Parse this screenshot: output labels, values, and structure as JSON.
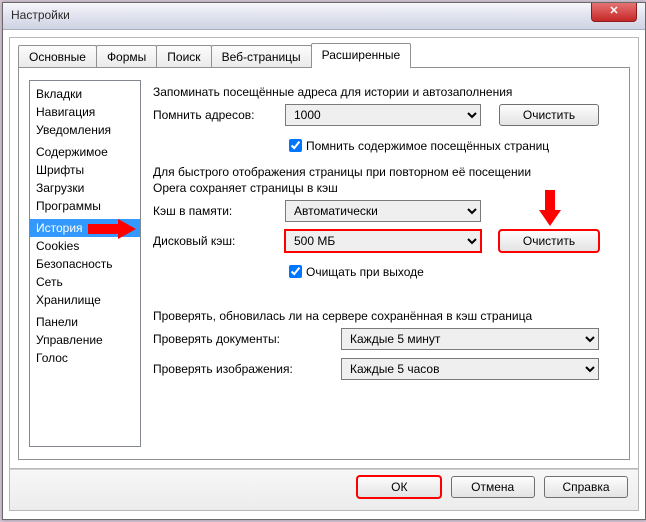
{
  "window": {
    "title": "Настройки"
  },
  "tabs": {
    "items": [
      "Основные",
      "Формы",
      "Поиск",
      "Веб-страницы",
      "Расширенные"
    ],
    "selected": 4
  },
  "sidebar": {
    "groups": [
      [
        "Вкладки",
        "Навигация",
        "Уведомления"
      ],
      [
        "Содержимое",
        "Шрифты",
        "Загрузки",
        "Программы"
      ],
      [
        "История",
        "Cookies",
        "Безопасность",
        "Сеть",
        "Хранилище"
      ],
      [
        "Панели",
        "Управление",
        "Голос"
      ]
    ],
    "selected": "История"
  },
  "content": {
    "sec1_title": "Запоминать посещённые адреса для истории и автозаполнения",
    "addresses_label": "Помнить адресов:",
    "addresses_value": "1000",
    "clear1": "Очистить",
    "remember_content": "Помнить содержимое посещённых страниц",
    "sec2_line1": "Для быстрого отображения страницы при повторном её посещении",
    "sec2_line2": "Opera сохраняет страницы в кэш",
    "mem_label": "Кэш в памяти:",
    "mem_value": "Автоматически",
    "disk_label": "Дисковый кэш:",
    "disk_value": "500 МБ",
    "clear2": "Очистить",
    "clear_on_exit": "Очищать при выходе",
    "sec3_title": "Проверять, обновилась ли на сервере сохранённая в кэш страница",
    "docs_label": "Проверять документы:",
    "docs_value": "Каждые 5 минут",
    "imgs_label": "Проверять изображения:",
    "imgs_value": "Каждые 5 часов"
  },
  "buttons": {
    "ok": "ОК",
    "cancel": "Отмена",
    "help": "Справка"
  }
}
